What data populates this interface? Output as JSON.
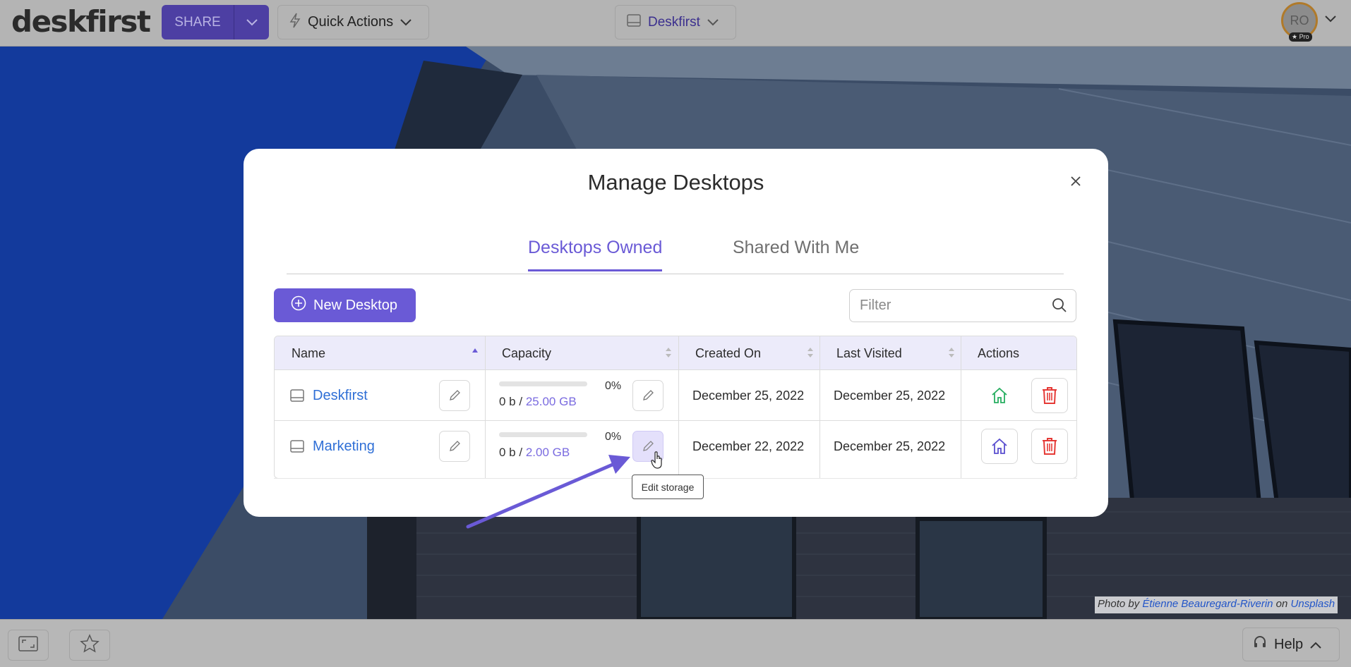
{
  "topbar": {
    "logo": "deskfirst",
    "share_label": "SHARE",
    "quick_actions_label": "Quick Actions",
    "desktop_selector_label": "Deskfirst",
    "avatar_initials": "RO",
    "pro_badge": "★ Pro"
  },
  "modal": {
    "title": "Manage Desktops",
    "tabs": [
      {
        "label": "Desktops Owned",
        "active": true
      },
      {
        "label": "Shared With Me",
        "active": false
      }
    ],
    "new_desktop_label": "New Desktop",
    "filter_placeholder": "Filter",
    "columns": [
      "Name",
      "Capacity",
      "Created On",
      "Last Visited",
      "Actions"
    ],
    "rows": [
      {
        "name": "Deskfirst",
        "used": "0 b /",
        "total": "25.00 GB",
        "percent": "0%",
        "created_on": "December 25, 2022",
        "last_visited": "December 25, 2022",
        "is_home": true
      },
      {
        "name": "Marketing",
        "used": "0 b /",
        "total": "2.00 GB",
        "percent": "0%",
        "created_on": "December 22, 2022",
        "last_visited": "December 25, 2022",
        "is_home": false
      }
    ],
    "tooltip": "Edit storage"
  },
  "credit": {
    "prefix": "Photo by",
    "author": "Étienne Beauregard-Riverin",
    "middle": "on",
    "source": "Unsplash"
  },
  "bottombar": {
    "help_label": "Help"
  },
  "colors": {
    "accent": "#6a5ad6",
    "share_bg": "#4d3fa3",
    "link": "#2f6fd6",
    "home_green": "#27ae60",
    "delete_red": "#e53935"
  }
}
